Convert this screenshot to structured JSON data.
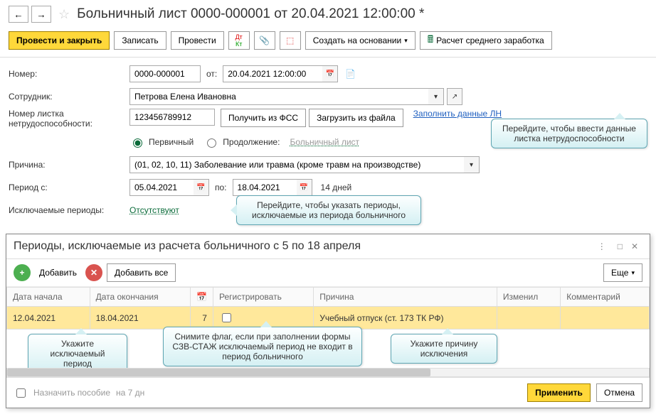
{
  "title": "Больничный лист 0000-000001 от 20.04.2021 12:00:00 *",
  "toolbar": {
    "post_and_close": "Провести и закрыть",
    "save": "Записать",
    "post": "Провести",
    "create_based_on": "Создать на основании",
    "calc_avg": "Расчет среднего заработка"
  },
  "form": {
    "number_label": "Номер:",
    "number_value": "0000-000001",
    "from_label": "от:",
    "date_value": "20.04.2021 12:00:00",
    "employee_label": "Сотрудник:",
    "employee_value": "Петрова Елена Ивановна",
    "sheet_number_label": "Номер листка нетрудоспособности:",
    "sheet_number_value": "123456789912",
    "get_fss": "Получить из ФСС",
    "load_file": "Загрузить из файла",
    "fill_ln": "Заполнить данные ЛН",
    "primary_label": "Первичный",
    "continuation_label": "Продолжение:",
    "continuation_link": "Больничный лист",
    "reason_label": "Причина:",
    "reason_value": "(01, 02, 10, 11) Заболевание или травма (кроме травм на производстве)",
    "period_from_label": "Период с:",
    "period_from_value": "05.04.2021",
    "period_to_label": "по:",
    "period_to_value": "18.04.2021",
    "days_text": "14 дней",
    "excluded_label": "Исключаемые периоды:",
    "excluded_link": "Отсутствуют"
  },
  "callouts": {
    "fill_ln": "Перейдите, чтобы ввести данные листка нетрудоспособности",
    "excluded": "Перейдите, чтобы указать периоды, исключаемые из периода больничного",
    "period": "Укажите исключаемый период",
    "flag": "Снимите флаг, если при заполнении формы СЗВ-СТАЖ исключаемый период не входит в период больничного",
    "reason": "Укажите причину исключения"
  },
  "subwin": {
    "title": "Периоды, исключаемые из расчета больничного с 5 по 18 апреля",
    "add": "Добавить",
    "add_all": "Добавить все",
    "more": "Еще",
    "columns": {
      "start": "Дата начала",
      "end": "Дата окончания",
      "cal": "",
      "register": "Регистрировать",
      "reason": "Причина",
      "changed": "Изменил",
      "comment": "Комментарий"
    },
    "row": {
      "start": "12.04.2021",
      "end": "18.04.2021",
      "days": "7",
      "reason": "Учебный отпуск (ст. 173 ТК РФ)"
    },
    "footer": {
      "assign_benefit": "Назначить пособие",
      "days_suffix": "на 7 дн",
      "apply": "Применить",
      "cancel": "Отмена"
    }
  }
}
